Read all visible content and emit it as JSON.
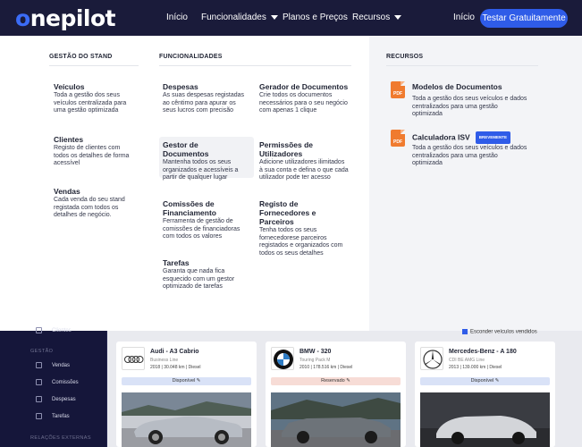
{
  "nav": {
    "logo": "onepilot",
    "links": [
      "Início",
      "Funcionalidades",
      "Planos e Preços",
      "Recursos",
      "Início"
    ],
    "cta": "Testar Gratuitamente"
  },
  "menu": {
    "stand": {
      "heading": "GESTÃO DO STAND",
      "items": [
        {
          "title": "Veículos",
          "desc": "Toda a gestão dos seus veículos centralizada para uma gestão optimizada"
        },
        {
          "title": "Clientes",
          "desc": "Registo de clientes com todos os detalhes de forma acessível"
        },
        {
          "title": "Vendas",
          "desc": "Cada venda do seu stand registada com todos os detalhes de negócio."
        }
      ]
    },
    "func": {
      "heading": "FUNCIONALIDADES",
      "items": [
        {
          "title": "Despesas",
          "desc": "As suas despesas registadas ao cêntimo para apurar os seus lucros com precisão"
        },
        {
          "title": "Gerador de Documentos",
          "desc": "Crie todos os documentos necessários para o seu negócio com apenas 1 clique"
        },
        {
          "title": "Gestor de Documentos",
          "desc": "Mantenha todos os seus organizados e acessíveis a partir de qualquer lugar"
        },
        {
          "title": "Permissões de Utilizadores",
          "desc": "Adicione utilizadores ilimitados à sua conta e defina o que cada utilizador pode ter acesso"
        },
        {
          "title": "Comissões de Financiamento",
          "desc": "Ferramenta de gestão de comissões de financiadoras com todos os valores"
        },
        {
          "title": "Registo de Fornecedores e Parceiros",
          "desc": "Tenha todos os seus fornecedorese parceiros registados e organizados com todos os seus detalhes"
        },
        {
          "title": "Tarefas",
          "desc": "Garanta que nada fica esquecido com um gestor optimizado de tarefas"
        }
      ]
    },
    "resources": {
      "heading": "RECURSOS",
      "pdf_label": "PDF",
      "badge": "BREVEMENTE",
      "items": [
        {
          "title": "Modelos de Documentos",
          "desc": "Toda a gestão dos seus veículos e dados centralizados para uma gestão optimizada"
        },
        {
          "title": "Calculadora ISV",
          "desc": "Toda a gestão dos seus veículos e dados centralizados para uma gestão optimizada"
        }
      ]
    }
  },
  "app": {
    "sidebar": {
      "top_item": "Clientes",
      "section1": "GESTÃO",
      "items": [
        "Vendas",
        "Comissões",
        "Despesas",
        "Tarefas"
      ],
      "section2": "RELAÇÕES EXTERNAS"
    },
    "checkbox_label": "Esconder veículos vendidos",
    "cars": [
      {
        "name": "Audi - A3 Cabrio",
        "sub": "Business Line",
        "year": "2018",
        "km": "30.048 km",
        "fuel": "Diesel",
        "status": "Disponível"
      },
      {
        "name": "BMW - 320",
        "sub": "Touring Pack M",
        "year": "2010",
        "km": "178.516 km",
        "fuel": "Diesel",
        "status": "Reservado"
      },
      {
        "name": "Mercedes-Benz - A 180",
        "sub": "CDI BE AMG Line",
        "year": "2013",
        "km": "139.000 km",
        "fuel": "Diesel",
        "status": "Disponível"
      }
    ]
  }
}
